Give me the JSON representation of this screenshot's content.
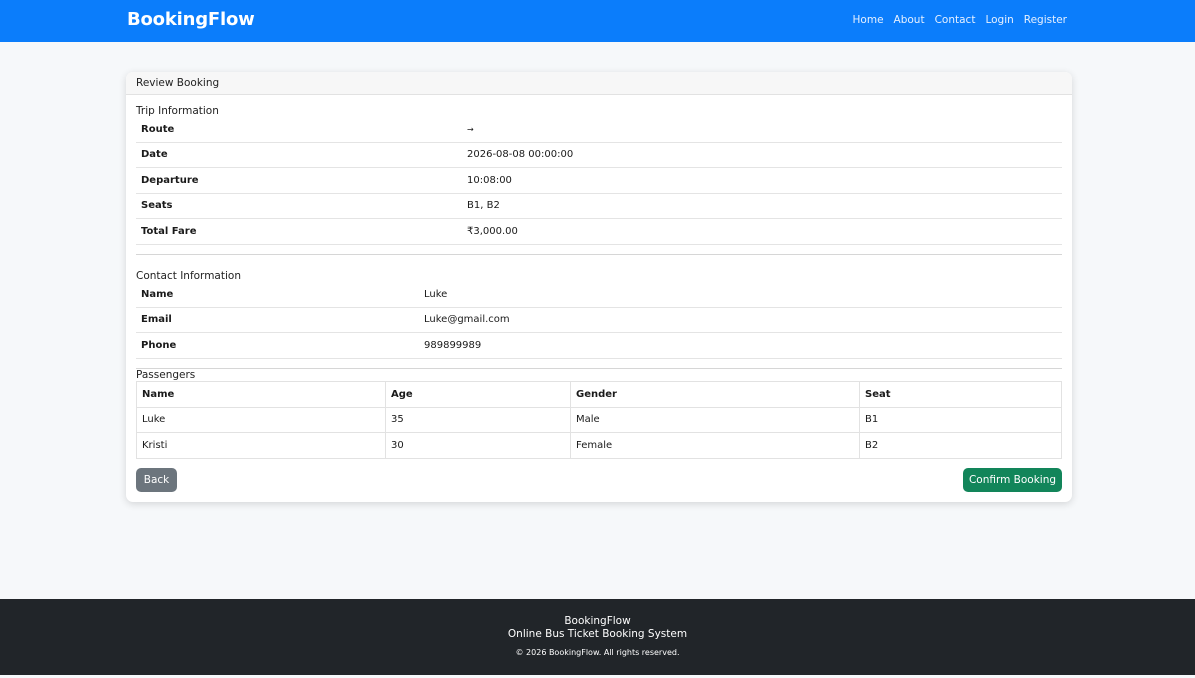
{
  "nav": {
    "brand": "BookingFlow",
    "links": [
      "Home",
      "About",
      "Contact",
      "Login",
      "Register"
    ]
  },
  "card": {
    "header": "Review Booking",
    "trip_title": "Trip Information",
    "trip": [
      {
        "label": "Route",
        "value": "→"
      },
      {
        "label": "Date",
        "value": "2026-08-08 00:00:00"
      },
      {
        "label": "Departure",
        "value": "10:08:00"
      },
      {
        "label": "Seats",
        "value": "B1, B2"
      },
      {
        "label": "Total Fare",
        "value": "₹3,000.00"
      }
    ],
    "contact_title": "Contact Information",
    "contact": [
      {
        "label": "Name",
        "value": "Luke"
      },
      {
        "label": "Email",
        "value": "Luke@gmail.com"
      },
      {
        "label": "Phone",
        "value": "989899989"
      }
    ],
    "passengers_title": "Passengers",
    "passenger_headers": [
      "Name",
      "Age",
      "Gender",
      "Seat"
    ],
    "passengers": [
      [
        "Luke",
        "35",
        "Male",
        "B1"
      ],
      [
        "Kristi",
        "30",
        "Female",
        "B2"
      ]
    ],
    "back_label": "Back",
    "confirm_label": "Confirm Booking"
  },
  "footer": {
    "brand": "BookingFlow",
    "tagline": "Online Bus Ticket Booking System",
    "copyright": "© 2026 BookingFlow. All rights reserved."
  },
  "colors": {
    "navbar": "#0b7dfb",
    "back_button": "#6c757d",
    "confirm_button": "#12855a",
    "footer": "#212529"
  }
}
